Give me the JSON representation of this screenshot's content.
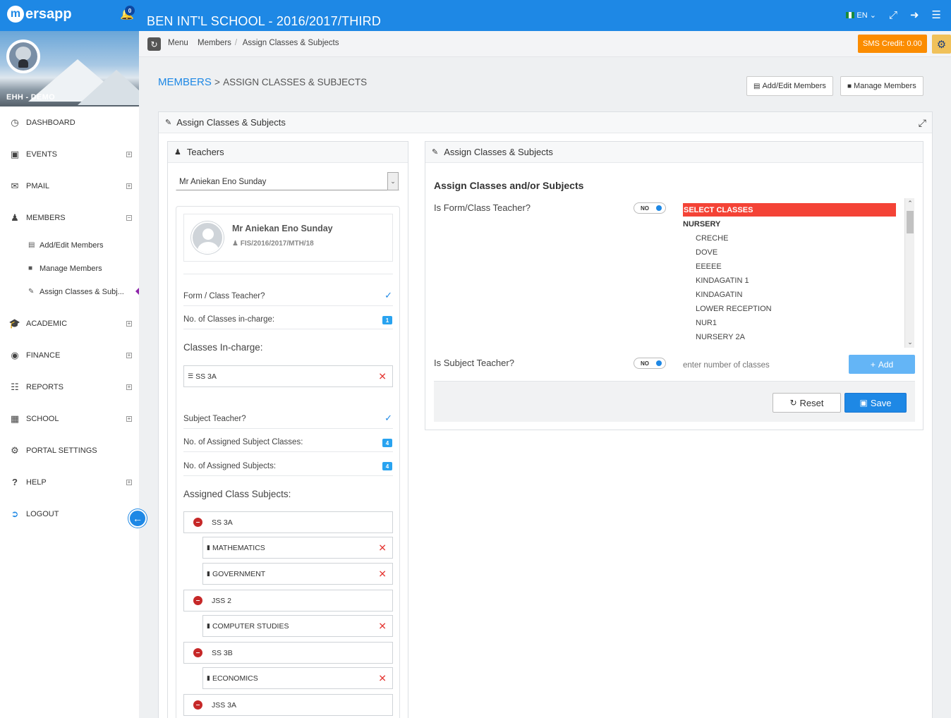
{
  "topbar": {
    "logo": "ersapp",
    "logo_mark": "m",
    "notif_count": "0",
    "school_title": "BEN INT'L SCHOOL - 2016/2017/THIRD",
    "lang": "EN",
    "icons": [
      "bell-icon",
      "fullscreen-icon",
      "logout-icon",
      "menu-icon"
    ]
  },
  "profile": {
    "name": "EHH - DEMO"
  },
  "sidebar": {
    "items": [
      {
        "label": "DASHBOARD",
        "icon": "dashboard-icon"
      },
      {
        "label": "EVENTS",
        "icon": "calendar-icon"
      },
      {
        "label": "PMAIL",
        "icon": "mail-icon"
      },
      {
        "label": "MEMBERS",
        "icon": "users-icon"
      },
      {
        "label": "ACADEMIC",
        "icon": "graduation-cap-icon"
      },
      {
        "label": "FINANCE",
        "icon": "money-icon"
      },
      {
        "label": "REPORTS",
        "icon": "clipboard-icon"
      },
      {
        "label": "SCHOOL",
        "icon": "building-icon"
      },
      {
        "label": "PORTAL SETTINGS",
        "icon": "gear-icon"
      },
      {
        "label": "HELP",
        "icon": "question-icon"
      },
      {
        "label": "LOGOUT",
        "icon": "sign-out-icon"
      }
    ],
    "members_sub": [
      {
        "label": "Add/Edit Members"
      },
      {
        "label": "Manage Members"
      },
      {
        "label": "Assign Classes & Subj..."
      }
    ]
  },
  "breadcrumb": {
    "items": [
      "Menu",
      "Members",
      "Assign Classes & Subjects"
    ]
  },
  "sms_credit": "SMS Credit: 0.00",
  "page": {
    "title_main": "MEMBERS",
    "title_sep": ">",
    "title_sub": "ASSIGN CLASSES & SUBJECTS",
    "btn_add_edit": "Add/Edit Members",
    "btn_manage": "Manage Members",
    "panel_title": "Assign Classes & Subjects"
  },
  "teachers": {
    "panel_title": "Teachers",
    "selected": "Mr Aniekan Eno Sunday",
    "name": "Mr Aniekan Eno Sunday",
    "id": "FIS/2016/2017/MTH/18",
    "form_teacher_label": "Form / Class Teacher?",
    "classes_incharge_count_label": "No. of Classes in-charge:",
    "classes_incharge_count": "1",
    "classes_incharge_title": "Classes In-charge:",
    "classes_incharge": [
      "SS 3A"
    ],
    "subject_teacher_label": "Subject Teacher?",
    "assigned_subject_classes_label": "No. of Assigned Subject Classes:",
    "assigned_subject_classes_count": "4",
    "assigned_subjects_label": "No. of Assigned Subjects:",
    "assigned_subjects_count": "4",
    "assigned_title": "Assigned Class Subjects:",
    "assigned": [
      {
        "class": "SS 3A",
        "subjects": [
          "MATHEMATICS",
          "GOVERNMENT"
        ]
      },
      {
        "class": "JSS 2",
        "subjects": [
          "COMPUTER STUDIES"
        ]
      },
      {
        "class": "SS 3B",
        "subjects": [
          "ECONOMICS"
        ]
      },
      {
        "class": "JSS 3A",
        "subjects": []
      }
    ]
  },
  "assign": {
    "panel_title": "Assign Classes & Subjects",
    "heading": "Assign Classes and/or Subjects",
    "form_teacher_q": "Is Form/Class Teacher?",
    "subject_teacher_q": "Is Subject Teacher?",
    "toggle_off": "NO",
    "select_header": "SELECT CLASSES",
    "group": "NURSERY",
    "classes": [
      "CRECHE",
      "DOVE",
      "EEEEE",
      "KINDAGATIN 1",
      "KINDAGATIN",
      "LOWER RECEPTION",
      "NUR1",
      "NURSERY 2A"
    ],
    "num_placeholder": "enter number of classes",
    "add_label": "Add",
    "reset_label": "Reset",
    "save_label": "Save"
  },
  "colors": {
    "primary": "#1e88e5",
    "danger": "#f44336",
    "warning": "#fb8c00"
  }
}
